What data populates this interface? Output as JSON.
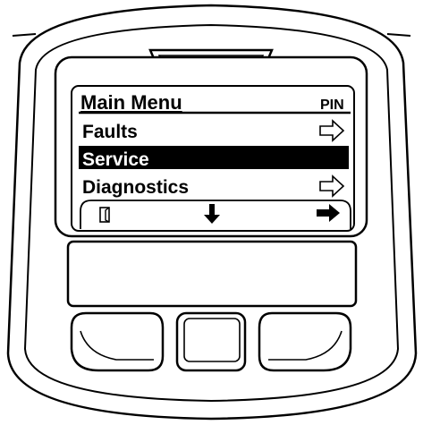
{
  "menu": {
    "title": "Main Menu",
    "title_badge": "PIN",
    "items": [
      {
        "label": "Faults",
        "selected": false,
        "has_arrow": true
      },
      {
        "label": "Service",
        "selected": true,
        "has_arrow": false
      },
      {
        "label": "Diagnostics",
        "selected": false,
        "has_arrow": true
      }
    ]
  },
  "softkey_icons": [
    "exit-door-icon",
    "arrow-down-icon",
    "arrow-right-icon"
  ],
  "buttons": [
    "left-softkey-button",
    "center-softkey-button",
    "right-softkey-button"
  ],
  "colors": {
    "ink": "#000000",
    "paper": "#ffffff",
    "selection": "#000000"
  }
}
